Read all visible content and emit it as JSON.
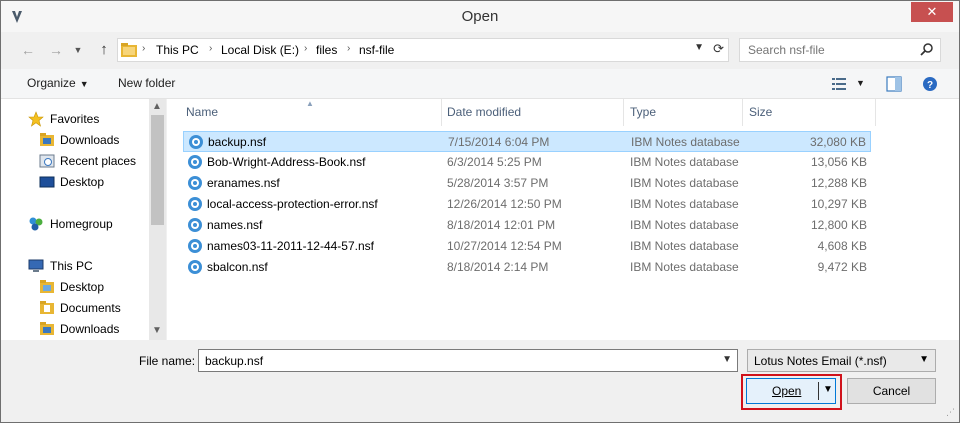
{
  "window": {
    "title": "Open",
    "close_glyph": "✕"
  },
  "nav": {
    "back_glyph": "←",
    "forward_glyph": "→",
    "up_glyph": "↑",
    "breadcrumbs": [
      "This PC",
      "Local Disk (E:)",
      "files",
      "nsf-file"
    ],
    "search_placeholder": "Search nsf-file"
  },
  "toolbar": {
    "organize_label": "Organize",
    "new_folder_label": "New folder"
  },
  "sidebar": {
    "items": [
      {
        "label": "Favorites",
        "icon": "star-icon"
      },
      {
        "label": "Downloads",
        "icon": "folder-icon"
      },
      {
        "label": "Recent places",
        "icon": "recent-places-icon"
      },
      {
        "label": "Desktop",
        "icon": "desktop-icon"
      },
      {
        "label": "Homegroup",
        "icon": "homegroup-icon"
      },
      {
        "label": "This PC",
        "icon": "computer-icon"
      },
      {
        "label": "Desktop",
        "icon": "folder-icon"
      },
      {
        "label": "Documents",
        "icon": "folder-icon"
      },
      {
        "label": "Downloads",
        "icon": "folder-icon"
      }
    ]
  },
  "filelist": {
    "columns": [
      "Name",
      "Date modified",
      "Type",
      "Size"
    ],
    "rows": [
      {
        "name": "backup.nsf",
        "date": "7/15/2014 6:04 PM",
        "type": "IBM Notes database",
        "size": "32,080 KB",
        "selected": true
      },
      {
        "name": "Bob-Wright-Address-Book.nsf",
        "date": "6/3/2014 5:25 PM",
        "type": "IBM Notes database",
        "size": "13,056 KB"
      },
      {
        "name": "eranames.nsf",
        "date": "5/28/2014 3:57 PM",
        "type": "IBM Notes database",
        "size": "12,288 KB"
      },
      {
        "name": "local-access-protection-error.nsf",
        "date": "12/26/2014 12:50 PM",
        "type": "IBM Notes database",
        "size": "10,297 KB"
      },
      {
        "name": "names.nsf",
        "date": "8/18/2014 12:01 PM",
        "type": "IBM Notes database",
        "size": "12,800 KB"
      },
      {
        "name": "names03-11-2011-12-44-57.nsf",
        "date": "10/27/2014 12:54 PM",
        "type": "IBM Notes database",
        "size": "4,608 KB"
      },
      {
        "name": "sbalcon.nsf",
        "date": "8/18/2014 2:14 PM",
        "type": "IBM Notes database",
        "size": "9,472 KB"
      }
    ]
  },
  "bottom": {
    "file_name_label": "File name:",
    "file_name_value": "backup.nsf",
    "file_type_value": "Lotus Notes Email (*.nsf)",
    "open_label": "Open",
    "cancel_label": "Cancel"
  },
  "colors": {
    "selection_bg": "#cce8ff",
    "selection_border": "#99d1ff",
    "highlight_red": "#d0121b",
    "accent_blue": "#0078d7"
  }
}
